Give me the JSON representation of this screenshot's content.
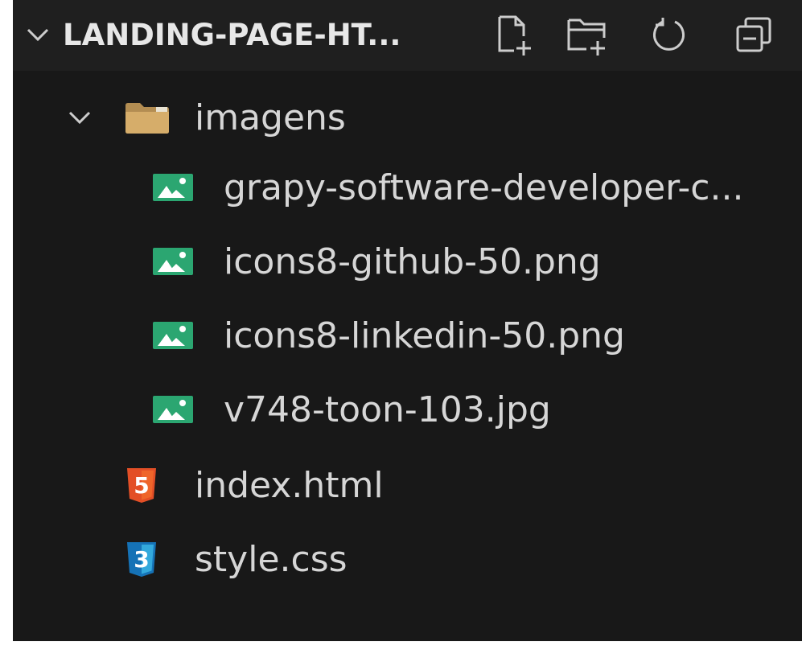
{
  "explorer": {
    "title": "LANDING-PAGE-HT...",
    "actions": [
      {
        "name": "new-file-icon"
      },
      {
        "name": "new-folder-icon"
      },
      {
        "name": "refresh-icon"
      },
      {
        "name": "collapse-all-icon"
      }
    ],
    "tree": {
      "folder": {
        "label": "imagens",
        "icon": "folder-icon",
        "expanded": true
      },
      "images": [
        {
          "label": "grapy-software-developer-c...",
          "icon": "image-file-icon"
        },
        {
          "label": "icons8-github-50.png",
          "icon": "image-file-icon"
        },
        {
          "label": "icons8-linkedin-50.png",
          "icon": "image-file-icon"
        },
        {
          "label": "v748-toon-103.jpg",
          "icon": "image-file-icon"
        }
      ],
      "files": [
        {
          "label": "index.html",
          "icon": "html5-icon",
          "glyph": "5",
          "color": "#e44d26"
        },
        {
          "label": "style.css",
          "icon": "css3-icon",
          "glyph": "3",
          "color": "#1572b6"
        }
      ]
    }
  },
  "colors": {
    "background": "#181818",
    "header_background": "#1f1f1f",
    "text": "#d6d6d6",
    "image_icon": "#26a269",
    "folder": "#c09553"
  }
}
